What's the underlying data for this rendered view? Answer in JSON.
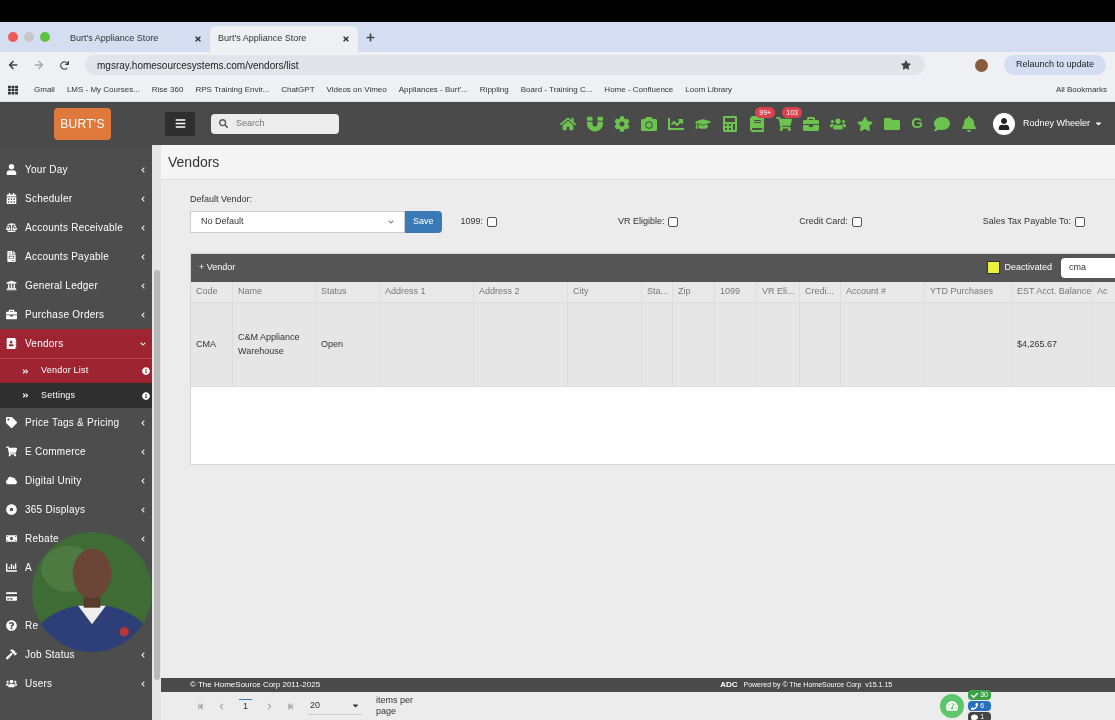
{
  "browser": {
    "tabs": [
      {
        "title": "Burt's Appliance Store",
        "selected": false
      },
      {
        "title": "Burt's Appliance Store",
        "selected": true
      }
    ],
    "url": "mgsray.homesourcesystems.com/vendors/list",
    "relaunch": "Relaunch to update",
    "bookmarks": [
      "Gmail",
      "LMS - My Courses...",
      "Rise 360",
      "RPS Training Envir...",
      "ChatGPT",
      "Videos on Vimeo",
      "Appliances - Burt'...",
      "Rippling",
      "Board - Training C...",
      "Home - Confluence",
      "Loom Library"
    ],
    "all_bookmarks": "All Bookmarks"
  },
  "header": {
    "logo": "BURT'S",
    "search_placeholder": "Search",
    "notebook_badge": "99+",
    "cart_badge": "103",
    "g_label": "G",
    "user": "Rodney Wheeler"
  },
  "sidebar": [
    {
      "label": "Your Day",
      "selected": false,
      "expanded": false
    },
    {
      "label": "Scheduler",
      "selected": false,
      "expanded": false
    },
    {
      "label": "Accounts Receivable",
      "selected": false,
      "expanded": false
    },
    {
      "label": "Accounts Payable",
      "selected": false,
      "expanded": false
    },
    {
      "label": "General Ledger",
      "selected": false,
      "expanded": false
    },
    {
      "label": "Purchase Orders",
      "selected": false,
      "expanded": false
    },
    {
      "label": "Vendors",
      "selected": true,
      "expanded": true,
      "children": [
        {
          "label": "Vendor List",
          "selected": true
        },
        {
          "label": "Settings",
          "selected": false
        }
      ]
    },
    {
      "label": "Price Tags & Pricing",
      "selected": false,
      "expanded": false
    },
    {
      "label": "E Commerce",
      "selected": false,
      "expanded": false
    },
    {
      "label": "Digital Unity",
      "selected": false,
      "expanded": false
    },
    {
      "label": "365 Displays",
      "selected": false,
      "expanded": false
    },
    {
      "label": "Rebate",
      "selected": false,
      "expanded": false
    },
    {
      "label": "A",
      "selected": false
    },
    {
      "selected": false
    },
    {
      "label": "Re",
      "selected": false
    },
    {
      "label": "Job Status",
      "selected": false,
      "expanded": false
    },
    {
      "label": "Users",
      "selected": false,
      "expanded": false
    }
  ],
  "page": {
    "title": "Vendors",
    "default_vendor_label": "Default Vendor:",
    "default_vendor_value": "No Default",
    "save": "Save",
    "filters": [
      {
        "label": "1099:",
        "checked": false
      },
      {
        "label": "VR Eligible:",
        "checked": false
      },
      {
        "label": "Credit Card:",
        "checked": false
      },
      {
        "label": "Sales Tax Payable To:",
        "checked": false
      }
    ]
  },
  "table": {
    "add": "+ Vendor",
    "legend": {
      "label": "Deactivated",
      "color": "#e8f03a"
    },
    "search": "cma",
    "columns": [
      "Code",
      "Name",
      "Status",
      "Address 1",
      "Address 2",
      "City",
      "Sta...",
      "Zip",
      "1099",
      "VR Eli...",
      "Credi...",
      "Account #",
      "YTD Purchases",
      "EST Acct. Balance",
      "Ac"
    ],
    "rows": [
      [
        "CMA",
        "C&M Appliance Warehouse",
        "Open",
        "",
        "",
        "",
        "",
        "",
        "",
        "",
        "",
        "",
        "",
        "$4,265.67",
        ""
      ]
    ]
  },
  "footer": {
    "copyright": "© The HomeSource Corp 2011-2025",
    "adc": "ADC",
    "powered": "Powered by © The HomeSource Corp",
    "version": "v15.1.15"
  },
  "pager": {
    "page": "1",
    "page_size": "20",
    "items_label": "items per page"
  },
  "widget": {
    "tasks": "30",
    "calls": "6",
    "messages": "1"
  }
}
